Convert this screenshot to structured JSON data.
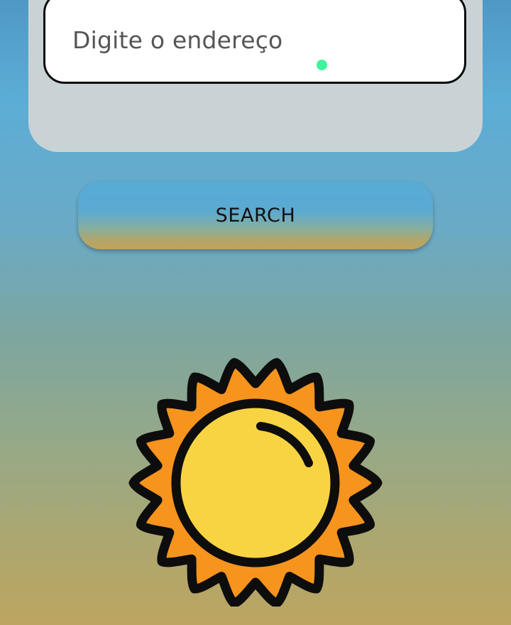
{
  "search_form": {
    "address_placeholder": "Digite o endereço",
    "search_label": "SEARCH"
  },
  "weather": {
    "icon": "sun-icon"
  },
  "colors": {
    "card_background": "#c9d3d6",
    "input_border": "#0b0b0b",
    "caret_dot": "#3ef59a",
    "sun_rays": "#f7941d",
    "sun_core": "#f9d442",
    "outline": "#0d0d0d"
  }
}
